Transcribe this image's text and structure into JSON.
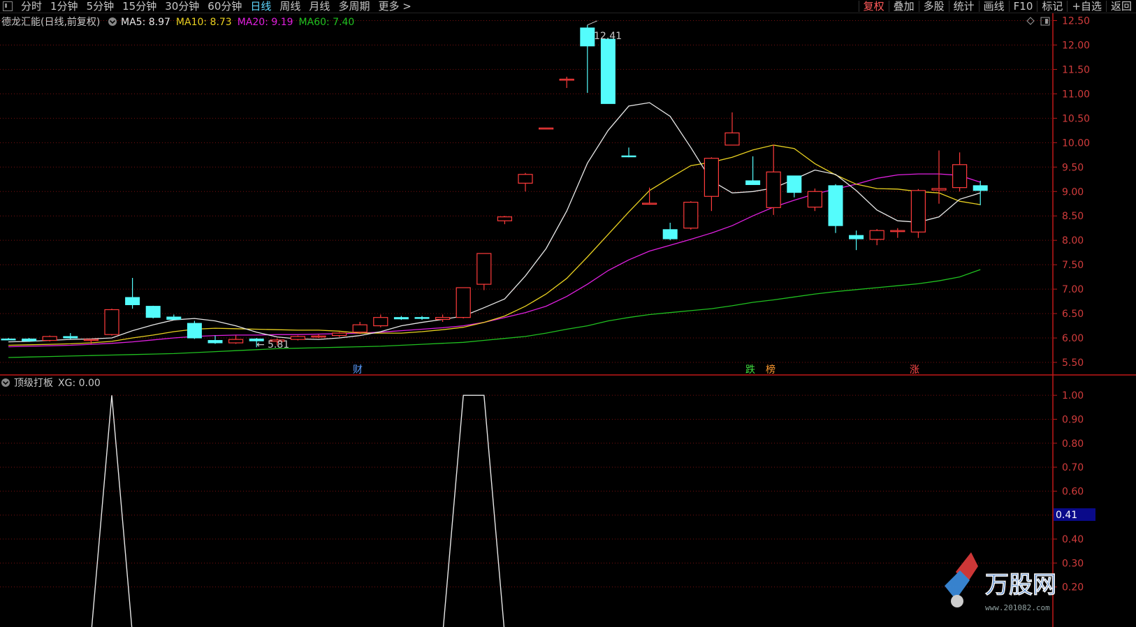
{
  "toolbar": {
    "tabs": [
      "分时",
      "1分钟",
      "5分钟",
      "15分钟",
      "30分钟",
      "60分钟",
      "日线",
      "周线",
      "月线",
      "多周期",
      "更多 >"
    ],
    "active_tab": "日线",
    "right_buttons": [
      "复权",
      "叠加",
      "多股",
      "统计",
      "画线",
      "F10",
      "标记",
      "+自选",
      "返回"
    ],
    "active_right": "复权"
  },
  "colors": {
    "up": "#ff3b3b",
    "down": "#54fcfc",
    "ma5": "#e8e8e8",
    "ma10": "#e8d020",
    "ma20": "#e020e0",
    "ma60": "#20c020",
    "axis": "#c01818",
    "grid": "#7a1010",
    "price_text": "#d23c3c",
    "indicator": "#e8e8e8"
  },
  "main_panel": {
    "title": "德龙汇能(日线,前复权)",
    "ma_labels": [
      {
        "text": "MA5: 8.97",
        "color": "#e8e8e8"
      },
      {
        "text": "MA10: 8.73",
        "color": "#e8d020"
      },
      {
        "text": "MA20: 9.19",
        "color": "#e020e0"
      },
      {
        "text": "MA60: 7.40",
        "color": "#20c020"
      }
    ],
    "high_label": "12.41",
    "low_label": "5.81",
    "event_markers": [
      {
        "text": "财",
        "color": "#5a9cff"
      },
      {
        "text": "跌",
        "color": "#40e040"
      },
      {
        "text": "榜",
        "color": "#ff9a30"
      },
      {
        "text": "涨",
        "color": "#ff4848"
      }
    ]
  },
  "indicator_panel": {
    "title": "顶级打板",
    "value_label": "XG: 0.00",
    "cursor_value": "0.41"
  },
  "watermark": {
    "brand": "万股网",
    "url": "www.201082.com"
  },
  "chart_data": {
    "type": "candlestick",
    "price_axis": {
      "ticks": [
        "12.50",
        "12.00",
        "11.50",
        "11.00",
        "10.50",
        "10.00",
        "9.50",
        "9.00",
        "8.50",
        "8.00",
        "7.50",
        "7.00",
        "6.50",
        "6.00",
        "5.50"
      ],
      "range": [
        5.3,
        12.65
      ]
    },
    "candles": [
      {
        "o": 5.98,
        "h": 6.0,
        "l": 5.95,
        "c": 5.97
      },
      {
        "o": 5.98,
        "h": 6.0,
        "l": 5.92,
        "c": 5.94
      },
      {
        "o": 5.95,
        "h": 6.05,
        "l": 5.93,
        "c": 6.03
      },
      {
        "o": 6.03,
        "h": 6.1,
        "l": 5.98,
        "c": 6.0
      },
      {
        "o": 5.95,
        "h": 5.98,
        "l": 5.88,
        "c": 5.97
      },
      {
        "o": 6.07,
        "h": 6.6,
        "l": 6.05,
        "c": 6.58
      },
      {
        "o": 6.83,
        "h": 7.23,
        "l": 6.6,
        "c": 6.68
      },
      {
        "o": 6.65,
        "h": 6.66,
        "l": 6.4,
        "c": 6.42
      },
      {
        "o": 6.43,
        "h": 6.48,
        "l": 6.37,
        "c": 6.38
      },
      {
        "o": 6.3,
        "h": 6.35,
        "l": 5.98,
        "c": 6.0
      },
      {
        "o": 5.95,
        "h": 6.05,
        "l": 5.88,
        "c": 5.9
      },
      {
        "o": 5.9,
        "h": 6.05,
        "l": 5.88,
        "c": 5.97
      },
      {
        "o": 5.98,
        "h": 6.0,
        "l": 5.81,
        "c": 5.94
      },
      {
        "o": 5.93,
        "h": 5.99,
        "l": 5.85,
        "c": 5.96
      },
      {
        "o": 5.97,
        "h": 6.05,
        "l": 5.95,
        "c": 6.03
      },
      {
        "o": 6.02,
        "h": 6.07,
        "l": 6.0,
        "c": 6.04
      },
      {
        "o": 6.05,
        "h": 6.12,
        "l": 6.02,
        "c": 6.1
      },
      {
        "o": 6.12,
        "h": 6.33,
        "l": 6.08,
        "c": 6.27
      },
      {
        "o": 6.25,
        "h": 6.48,
        "l": 6.22,
        "c": 6.42
      },
      {
        "o": 6.42,
        "h": 6.45,
        "l": 6.37,
        "c": 6.39
      },
      {
        "o": 6.42,
        "h": 6.45,
        "l": 6.37,
        "c": 6.4
      },
      {
        "o": 6.38,
        "h": 6.48,
        "l": 6.33,
        "c": 6.42
      },
      {
        "o": 6.42,
        "h": 7.03,
        "l": 6.4,
        "c": 7.03
      },
      {
        "o": 7.1,
        "h": 7.73,
        "l": 6.98,
        "c": 7.73
      },
      {
        "o": 8.4,
        "h": 8.5,
        "l": 8.33,
        "c": 8.48
      },
      {
        "o": 9.17,
        "h": 9.38,
        "l": 9.0,
        "c": 9.35
      },
      {
        "o": 10.28,
        "h": 10.3,
        "l": 10.28,
        "c": 10.3
      },
      {
        "o": 11.3,
        "h": 11.35,
        "l": 11.12,
        "c": 11.3
      },
      {
        "o": 12.35,
        "h": 12.41,
        "l": 11.02,
        "c": 11.98
      },
      {
        "o": 12.12,
        "h": 12.14,
        "l": 10.8,
        "c": 10.8
      },
      {
        "o": 9.73,
        "h": 9.9,
        "l": 9.7,
        "c": 9.72
      },
      {
        "o": 8.75,
        "h": 9.08,
        "l": 8.73,
        "c": 8.76
      },
      {
        "o": 8.22,
        "h": 8.36,
        "l": 8.0,
        "c": 8.03
      },
      {
        "o": 8.25,
        "h": 8.8,
        "l": 8.22,
        "c": 8.78
      },
      {
        "o": 8.9,
        "h": 9.7,
        "l": 8.6,
        "c": 9.68
      },
      {
        "o": 9.95,
        "h": 10.62,
        "l": 9.95,
        "c": 10.2
      },
      {
        "o": 9.22,
        "h": 9.72,
        "l": 9.15,
        "c": 9.14
      },
      {
        "o": 8.67,
        "h": 9.96,
        "l": 8.52,
        "c": 9.4
      },
      {
        "o": 9.32,
        "h": 9.32,
        "l": 8.88,
        "c": 8.98
      },
      {
        "o": 8.68,
        "h": 9.06,
        "l": 8.6,
        "c": 9.0
      },
      {
        "o": 9.12,
        "h": 9.15,
        "l": 8.15,
        "c": 8.3
      },
      {
        "o": 8.1,
        "h": 8.2,
        "l": 7.8,
        "c": 8.03
      },
      {
        "o": 8.02,
        "h": 8.23,
        "l": 7.9,
        "c": 8.2
      },
      {
        "o": 8.18,
        "h": 8.25,
        "l": 8.05,
        "c": 8.2
      },
      {
        "o": 8.17,
        "h": 9.05,
        "l": 8.05,
        "c": 9.02
      },
      {
        "o": 9.03,
        "h": 9.84,
        "l": 8.75,
        "c": 9.06
      },
      {
        "o": 9.08,
        "h": 9.8,
        "l": 9.0,
        "c": 9.55
      },
      {
        "o": 9.12,
        "h": 9.22,
        "l": 8.72,
        "c": 9.02
      }
    ],
    "ma5": [
      5.92,
      5.93,
      5.95,
      5.97,
      5.98,
      6.0,
      6.15,
      6.27,
      6.37,
      6.4,
      6.35,
      6.25,
      6.12,
      6.02,
      5.98,
      5.97,
      6.0,
      6.05,
      6.13,
      6.25,
      6.32,
      6.38,
      6.45,
      6.62,
      6.8,
      7.27,
      7.83,
      8.6,
      9.58,
      10.25,
      10.75,
      10.82,
      10.54,
      9.9,
      9.22,
      8.97,
      9.0,
      9.07,
      9.25,
      9.44,
      9.35,
      9.02,
      8.62,
      8.4,
      8.37,
      8.48,
      8.84,
      8.97
    ],
    "ma10": [
      5.85,
      5.86,
      5.87,
      5.88,
      5.9,
      5.93,
      6.0,
      6.06,
      6.13,
      6.18,
      6.2,
      6.19,
      6.18,
      6.17,
      6.16,
      6.16,
      6.14,
      6.1,
      6.1,
      6.1,
      6.13,
      6.17,
      6.22,
      6.32,
      6.45,
      6.65,
      6.9,
      7.22,
      7.66,
      8.12,
      8.58,
      9.02,
      9.28,
      9.53,
      9.6,
      9.7,
      9.85,
      9.95,
      9.88,
      9.57,
      9.34,
      9.15,
      9.06,
      9.05,
      9.0,
      8.97,
      8.8,
      8.73
    ],
    "ma20": [
      5.82,
      5.83,
      5.84,
      5.85,
      5.87,
      5.89,
      5.92,
      5.96,
      6.0,
      6.03,
      6.05,
      6.06,
      6.06,
      6.07,
      6.07,
      6.08,
      6.09,
      6.1,
      6.12,
      6.15,
      6.18,
      6.21,
      6.25,
      6.32,
      6.42,
      6.52,
      6.65,
      6.85,
      7.1,
      7.38,
      7.6,
      7.78,
      7.9,
      8.02,
      8.15,
      8.3,
      8.5,
      8.68,
      8.82,
      8.95,
      9.05,
      9.15,
      9.27,
      9.34,
      9.36,
      9.36,
      9.33,
      9.19
    ],
    "ma60": [
      5.6,
      5.61,
      5.62,
      5.63,
      5.64,
      5.65,
      5.66,
      5.67,
      5.68,
      5.7,
      5.72,
      5.74,
      5.76,
      5.78,
      5.79,
      5.8,
      5.81,
      5.82,
      5.83,
      5.85,
      5.87,
      5.89,
      5.91,
      5.95,
      5.99,
      6.03,
      6.1,
      6.18,
      6.25,
      6.35,
      6.42,
      6.48,
      6.52,
      6.56,
      6.6,
      6.66,
      6.73,
      6.78,
      6.84,
      6.9,
      6.95,
      6.99,
      7.03,
      7.07,
      7.11,
      7.17,
      7.25,
      7.4
    ],
    "indicator": {
      "name": "顶级打板",
      "series": "XG",
      "ticks": [
        "1.00",
        "0.90",
        "0.80",
        "0.70",
        "0.60",
        "0.50",
        "0.40",
        "0.30",
        "0.20"
      ],
      "range": [
        0.03,
        1.05
      ],
      "points": [
        {
          "i": 4,
          "v": 0
        },
        {
          "i": 5,
          "v": 1.0
        },
        {
          "i": 6,
          "v": 0
        },
        {
          "i": 21,
          "v": 0
        },
        {
          "i": 22,
          "v": 1.0
        },
        {
          "i": 23,
          "v": 1.0
        },
        {
          "i": 24,
          "v": 0
        }
      ]
    }
  }
}
